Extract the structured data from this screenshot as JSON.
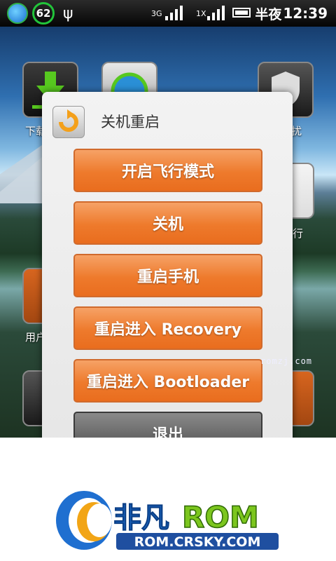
{
  "status_bar": {
    "battery_level_text": "62",
    "network_3g": "3G",
    "network_1x": "1X",
    "time_prefix": "半夜",
    "time": "12:39"
  },
  "background": {
    "visible_labels": [
      "下载",
      "扰",
      "用户",
      "行"
    ]
  },
  "dialog": {
    "title": "关机重启",
    "buttons": [
      {
        "label": "开启飞行模式"
      },
      {
        "label": "关机"
      },
      {
        "label": "重启手机"
      },
      {
        "label": "重启进入 Recovery"
      },
      {
        "label": "重启进入 Bootloader"
      },
      {
        "label": "退出"
      }
    ]
  },
  "watermark": "romzj.com",
  "logo": {
    "name_cn": "非凡",
    "name_en": "ROM",
    "url": "ROM.CRSKY.COM"
  },
  "colors": {
    "button_orange": "#ee7a2c",
    "button_grey": "#5a5a5a",
    "dialog_bg": "#eeeeee",
    "logo_blue": "#1f6fd0",
    "logo_green": "#7cc61e"
  }
}
